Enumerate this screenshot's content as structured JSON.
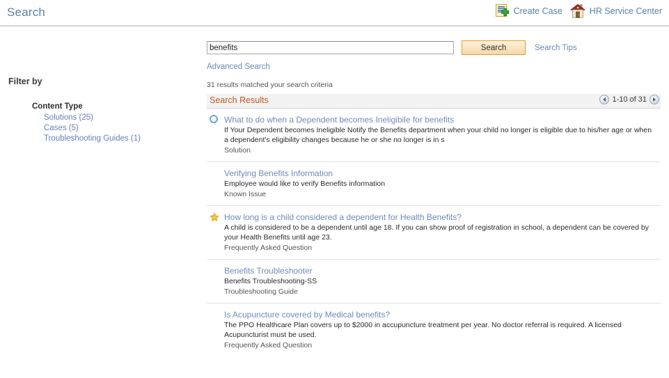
{
  "header": {
    "title": "Search",
    "links": [
      {
        "label": "Create Case",
        "icon": "create-case-icon"
      },
      {
        "label": "HR Service Center",
        "icon": "home-icon"
      }
    ]
  },
  "search": {
    "value": "benefits",
    "placeholder": "",
    "button_label": "Search",
    "tips_label": "Search Tips",
    "advanced_label": "Advanced Search",
    "results_count_text": "31 results matched your search criteria"
  },
  "sidebar": {
    "filter_by_label": "Filter by",
    "groups": [
      {
        "title": "Content Type",
        "items": [
          {
            "label": "Solutions (25)"
          },
          {
            "label": "Cases (5)"
          },
          {
            "label": "Troubleshooting Guides (1)"
          }
        ]
      }
    ]
  },
  "results_panel": {
    "title": "Search Results",
    "pager": {
      "prev_icon": "chevron-left-icon",
      "next_icon": "chevron-right-icon",
      "range_label": "1-10 of 31"
    },
    "items": [
      {
        "icon": "solution-circle-icon",
        "title": "What to do when a Dependent becomes Ineligibile for benefits",
        "snippet": "If Your Dependent becomes Ineligible Notify the Benefits department when your child no longer is eligible due to his/her age or when a dependent's eligibility changes because he or she no longer is in s",
        "type": "Solution"
      },
      {
        "icon": "none",
        "title": "Verifying Benefits Information",
        "snippet": "Employee would like to verify Benefits information",
        "type": "Known Issue"
      },
      {
        "icon": "star-icon",
        "title": "How long is a child considered a dependent for Health Benefits?",
        "snippet": "A child is considered to be a dependent until age 18. If you can show proof of registration in school, a dependent can be covered by your Health Benefits until age 23.",
        "type": "Frequently Asked Question"
      },
      {
        "icon": "none",
        "title": "Benefits Troubleshooter",
        "snippet": "Benefits Troubleshooting-SS",
        "type": "Troubleshooting Guide"
      },
      {
        "icon": "none",
        "title": "Is Acupuncture covered by Medical benefits?",
        "snippet": "The PPO Healthcare Plan covers up to $2000 in accupuncture treatment per year. No doctor referral is required. A licensed Acupuncturist must be used.",
        "type": "Frequently Asked Question"
      }
    ]
  },
  "colors": {
    "title_blue": "#5b7fad",
    "link_blue": "#7189bb",
    "accent_orange": "#c05a21",
    "button_border": "#e09a3e"
  }
}
